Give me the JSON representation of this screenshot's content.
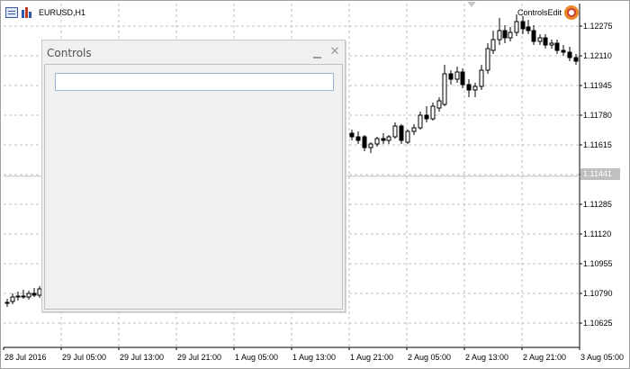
{
  "window": {
    "symbol_title": "EURUSD,H1",
    "expert_name": "ControlsEdit"
  },
  "price_axis": {
    "labels": [
      "1.12275",
      "1.12110",
      "1.11945",
      "1.11780",
      "1.11615",
      "1.11285",
      "1.11120",
      "1.10955",
      "1.10790",
      "1.10625"
    ],
    "current_price": "1.11441"
  },
  "time_axis": {
    "labels": [
      "28 Jul 2016",
      "29 Jul 05:00",
      "29 Jul 13:00",
      "29 Jul 21:00",
      "1 Aug 05:00",
      "1 Aug 13:00",
      "1 Aug 21:00",
      "2 Aug 05:00",
      "2 Aug 13:00",
      "2 Aug 21:00",
      "3 Aug 05:00"
    ]
  },
  "dialog": {
    "title": "Controls",
    "edit": {
      "value": "",
      "placeholder": ""
    }
  },
  "icons": {
    "minimize": "minimize-icon",
    "close": "close-icon",
    "expert": "expert-advisor-icon"
  },
  "colors": {
    "grid": "#c0c0c0",
    "bull_fill": "#ffffff",
    "bear_fill": "#000000",
    "current_price_tag": "#c0c0c0",
    "edit_border": "#9cb4d6"
  }
}
